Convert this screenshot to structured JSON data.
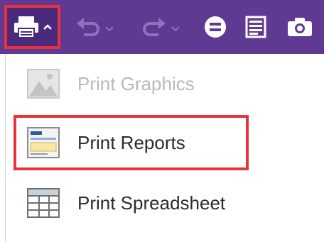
{
  "toolbar": {
    "background": "#5f3a92",
    "highlight_color": "#e8323e",
    "buttons": [
      {
        "name": "print-dropdown-button",
        "icon": "printer-icon",
        "has_dropdown": true
      },
      {
        "name": "undo-button",
        "icon": "undo-icon",
        "has_dropdown": true
      },
      {
        "name": "redo-button",
        "icon": "redo-icon",
        "has_dropdown": true
      },
      {
        "name": "equals-button",
        "icon": "equals-circle-icon"
      },
      {
        "name": "report-button",
        "icon": "report-icon"
      },
      {
        "name": "camera-button",
        "icon": "camera-icon"
      }
    ]
  },
  "menu": {
    "items": [
      {
        "label": "Print Graphics",
        "icon": "image-placeholder-icon",
        "enabled": false
      },
      {
        "label": "Print Reports",
        "icon": "report-document-icon",
        "enabled": true,
        "highlighted": true
      },
      {
        "label": "Print Spreadsheet",
        "icon": "spreadsheet-icon",
        "enabled": true
      }
    ]
  }
}
